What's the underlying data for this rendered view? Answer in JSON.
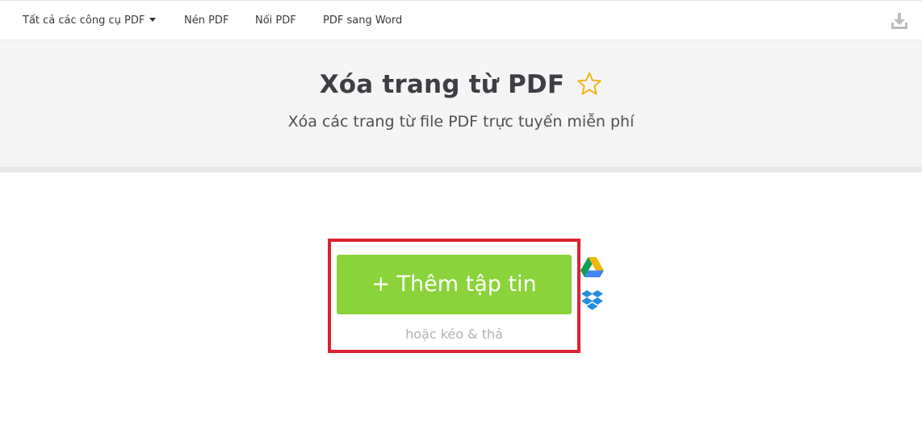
{
  "nav": {
    "all_tools": "Tất cả các công cụ PDF",
    "compress": "Nén PDF",
    "merge": "Nối PDF",
    "to_word": "PDF sang Word",
    "download_icon": "download-icon"
  },
  "hero": {
    "title": "Xóa trang từ PDF",
    "subtitle": "Xóa các trang từ file PDF trực tuyến miễn phí",
    "favorite_icon": "star-icon"
  },
  "upload": {
    "button_label": "+ Thêm tập tin",
    "drag_hint": "hoặc kéo & thả",
    "cloud_sources": [
      "google-drive-icon",
      "dropbox-icon"
    ]
  },
  "colors": {
    "button_green": "#8ad33a",
    "highlight_red": "#dc2230",
    "star_yellow": "#f3b51e",
    "hero_bg": "#f5f5f5"
  }
}
